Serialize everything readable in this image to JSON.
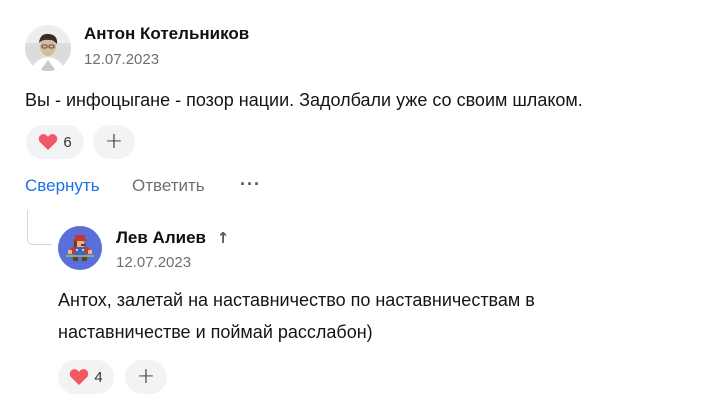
{
  "comment": {
    "author": "Антон Котельников",
    "date": "12.07.2023",
    "text": "Вы - инфоцыгане - позор нации. Задолбали уже со своим шлаком.",
    "likes": "6",
    "add_reaction": "+",
    "actions": {
      "collapse": "Свернуть",
      "reply": "Ответить",
      "more": "···"
    }
  },
  "reply": {
    "author": "Лев Алиев",
    "author_marker": "↑",
    "date": "12.07.2023",
    "text": "Антох, залетай на наставничество по наставничествам в наставничестве и поймай расслабон)",
    "likes": "4",
    "add_reaction": "+"
  },
  "colors": {
    "link_blue": "#1a73e8",
    "heart_red": "#f25863",
    "pill_bg": "#f2f3f5"
  },
  "icons": {
    "like": "heart-icon",
    "add": "plus-icon",
    "more": "more-dots-icon",
    "marker": "arrow-up-icon"
  }
}
